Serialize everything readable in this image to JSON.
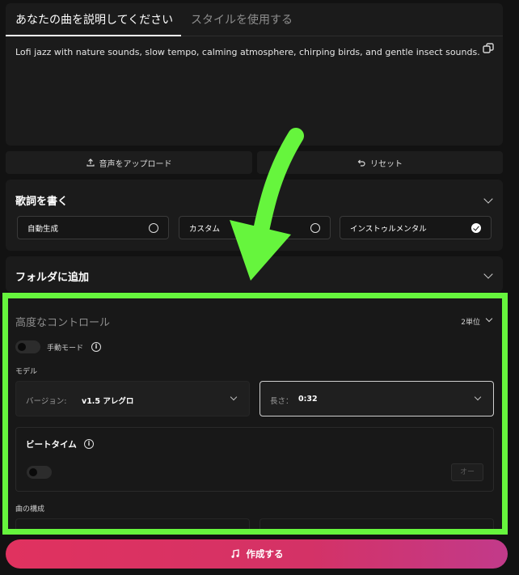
{
  "tabs": [
    {
      "label": "あなたの曲を説明してください",
      "active": true
    },
    {
      "label": "スタイルを使用する",
      "active": false
    }
  ],
  "prompt": {
    "text": "Lofi jazz with nature sounds, slow tempo, calming atmosphere, chirping birds, and gentle insect sounds.",
    "copy_icon": "copy-icon"
  },
  "actions": {
    "upload_label": "音声をアップロード",
    "upload_icon": "upload-icon",
    "reset_label": "リセット",
    "reset_icon": "undo-icon"
  },
  "lyrics": {
    "title": "歌詞を書く",
    "options": [
      {
        "label": "自動生成",
        "selected": false
      },
      {
        "label": "カスタム",
        "selected": false
      },
      {
        "label": "インストゥルメンタル",
        "selected": true
      }
    ]
  },
  "folder": {
    "title": "フォルダに追加"
  },
  "advanced": {
    "title": "高度なコントロール",
    "count": "2単位",
    "manual_mode_label": "手動モード",
    "model_label": "モデル",
    "version_label": "バージョン:",
    "version_value": "v1.5 アレグロ",
    "length_label": "長さ：",
    "length_value": "0:32",
    "beat_title": "ビートタイム",
    "beat_auto": "オー",
    "structure_label": "曲の構成"
  },
  "create": {
    "label": "作成する",
    "icon": "music-note-icon"
  },
  "colors": {
    "highlight": "#66f53d",
    "create_gradient_start": "#e0325f",
    "create_gradient_end": "#c23a8a",
    "background": "#121212"
  }
}
